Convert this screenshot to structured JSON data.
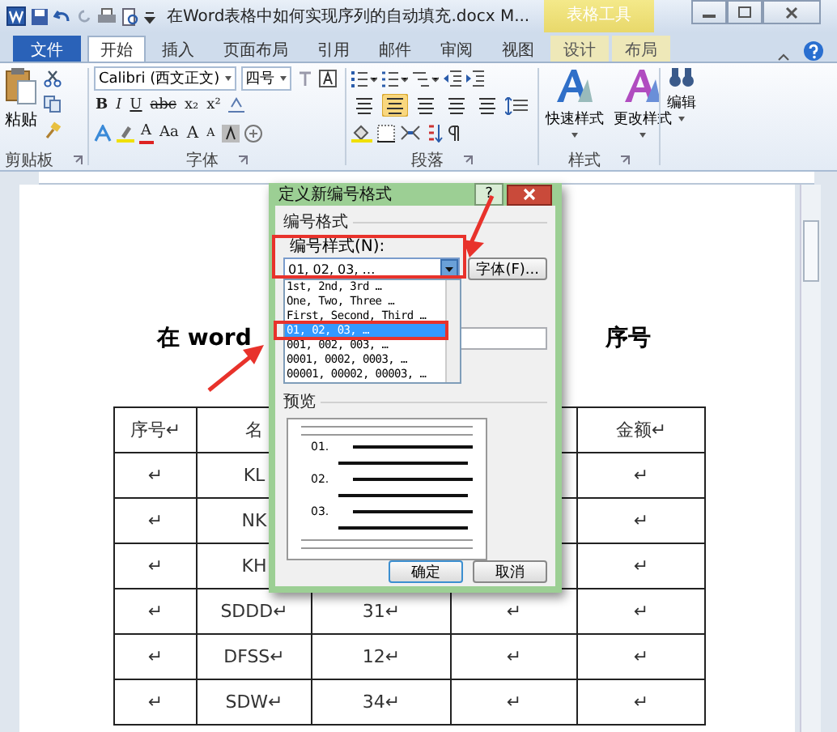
{
  "title_bar": {
    "title": "在Word表格中如何实现序列的自动填充.docx M...",
    "context_tab": "表格工具"
  },
  "tabs": [
    {
      "label": "文件",
      "kind": "file",
      "selected": false
    },
    {
      "label": "开始",
      "kind": "tab",
      "selected": true
    },
    {
      "label": "插入",
      "kind": "tab",
      "selected": false
    },
    {
      "label": "页面布局",
      "kind": "tab",
      "selected": false
    },
    {
      "label": "引用",
      "kind": "tab",
      "selected": false
    },
    {
      "label": "邮件",
      "kind": "tab",
      "selected": false
    },
    {
      "label": "审阅",
      "kind": "tab",
      "selected": false
    },
    {
      "label": "视图",
      "kind": "tab",
      "selected": false
    },
    {
      "label": "设计",
      "kind": "context",
      "selected": false
    },
    {
      "label": "布局",
      "kind": "context",
      "selected": false
    }
  ],
  "ribbon": {
    "clipboard": {
      "label": "剪贴板",
      "paste": "粘贴"
    },
    "font": {
      "label": "字体",
      "font_name": "Calibri (西文正文)",
      "font_size": "四号",
      "format_buttons": [
        "B",
        "I",
        "U",
        "abc",
        "x₂",
        "x²"
      ],
      "color_button": "A",
      "case_button": "Aa",
      "grow_button": "A",
      "shrink_button": "A"
    },
    "paragraph": {
      "label": "段落",
      "alignment": [
        {
          "selected": false
        },
        {
          "selected": true
        },
        {
          "selected": false
        },
        {
          "selected": false
        },
        {
          "selected": false
        }
      ]
    },
    "styles": {
      "label": "样式",
      "buttons": [
        "快速样式",
        "更改样式"
      ]
    },
    "editing": {
      "button": "编辑"
    }
  },
  "document": {
    "heading_parts": [
      "在 word",
      "序号"
    ],
    "table": [
      {
        "column_1": "序号↵",
        "column_2": "名",
        "column_5": "金额↵"
      },
      {
        "column_1": "↵",
        "column_2": "KL",
        "column_5": "↵"
      },
      {
        "column_1": "↵",
        "column_2": "NK",
        "column_5": "↵"
      },
      {
        "column_1": "↵",
        "column_2": "KH",
        "column_5": "↵"
      },
      {
        "column_1": "↵",
        "column_2": "SDDD↵",
        "column_3": "31↵",
        "column_4": "↵",
        "column_5": "↵"
      },
      {
        "column_1": "↵",
        "column_2": "DFSS↵",
        "column_3": "12↵",
        "column_4": "↵",
        "column_5": "↵"
      },
      {
        "column_1": "↵",
        "column_2": "SDW↵",
        "column_3": "34↵",
        "column_4": "↵",
        "column_5": "↵"
      }
    ]
  },
  "dialog": {
    "title": "定义新编号格式",
    "help": "?",
    "section": "编号格式",
    "style_label": "编号样式(N):",
    "style_value": "01, 02, 03, …",
    "font_button": "字体(F)...",
    "options": [
      {
        "label": "1st, 2nd, 3rd …",
        "selected": false
      },
      {
        "label": "One, Two, Three …",
        "selected": false
      },
      {
        "label": "First, Second, Third …",
        "selected": false
      },
      {
        "label": "01, 02, 03, …",
        "selected": true
      },
      {
        "label": "001, 002, 003, …",
        "selected": false
      },
      {
        "label": "0001, 0002, 0003, …",
        "selected": false
      },
      {
        "label": "00001, 00002, 00003, …",
        "selected": false
      }
    ],
    "preview_label": "预览",
    "preview_numbers": [
      "01.",
      "02.",
      "03."
    ],
    "ok": "确定",
    "cancel": "取消"
  }
}
